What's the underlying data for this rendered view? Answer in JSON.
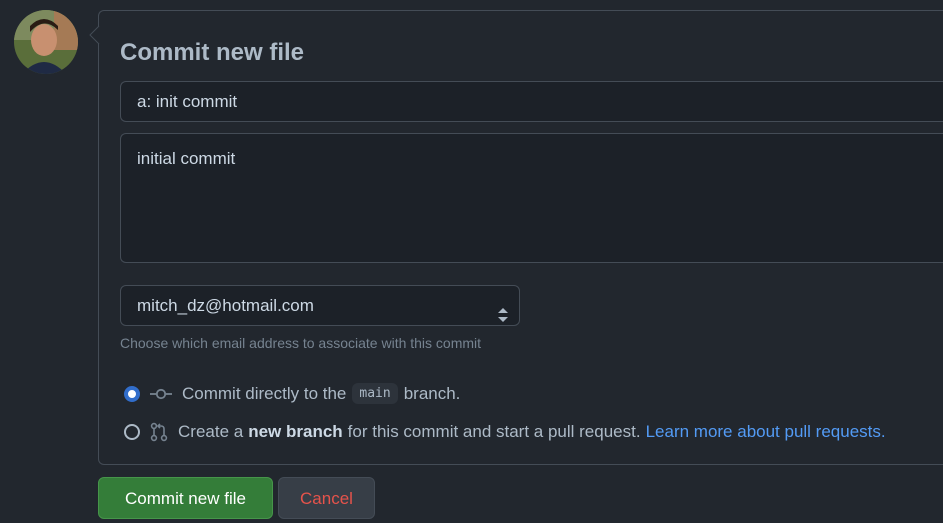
{
  "form": {
    "title": "Commit new file",
    "summary_value": "a: init commit",
    "description_value": "initial commit",
    "email_selected": "mitch_dz@hotmail.com",
    "email_hint": "Choose which email address to associate with this commit"
  },
  "options": {
    "direct": {
      "prefix": "Commit directly to the",
      "branch": "main",
      "suffix": "branch."
    },
    "new_branch": {
      "prefix": "Create a",
      "bold": "new branch",
      "suffix": "for this commit and start a pull request.",
      "link": "Learn more about pull requests."
    }
  },
  "buttons": {
    "commit_label": "Commit new file",
    "cancel_label": "Cancel"
  },
  "icons": {
    "avatar": "user-avatar",
    "commit": "git-commit-icon",
    "pull_request": "git-pull-request-icon",
    "select": "select-arrows-icon"
  },
  "colors": {
    "background": "#22272e",
    "primary_button": "#347d39",
    "link": "#539bf5",
    "cancel_text": "#e5534b",
    "radio_checked": "#316dca"
  }
}
